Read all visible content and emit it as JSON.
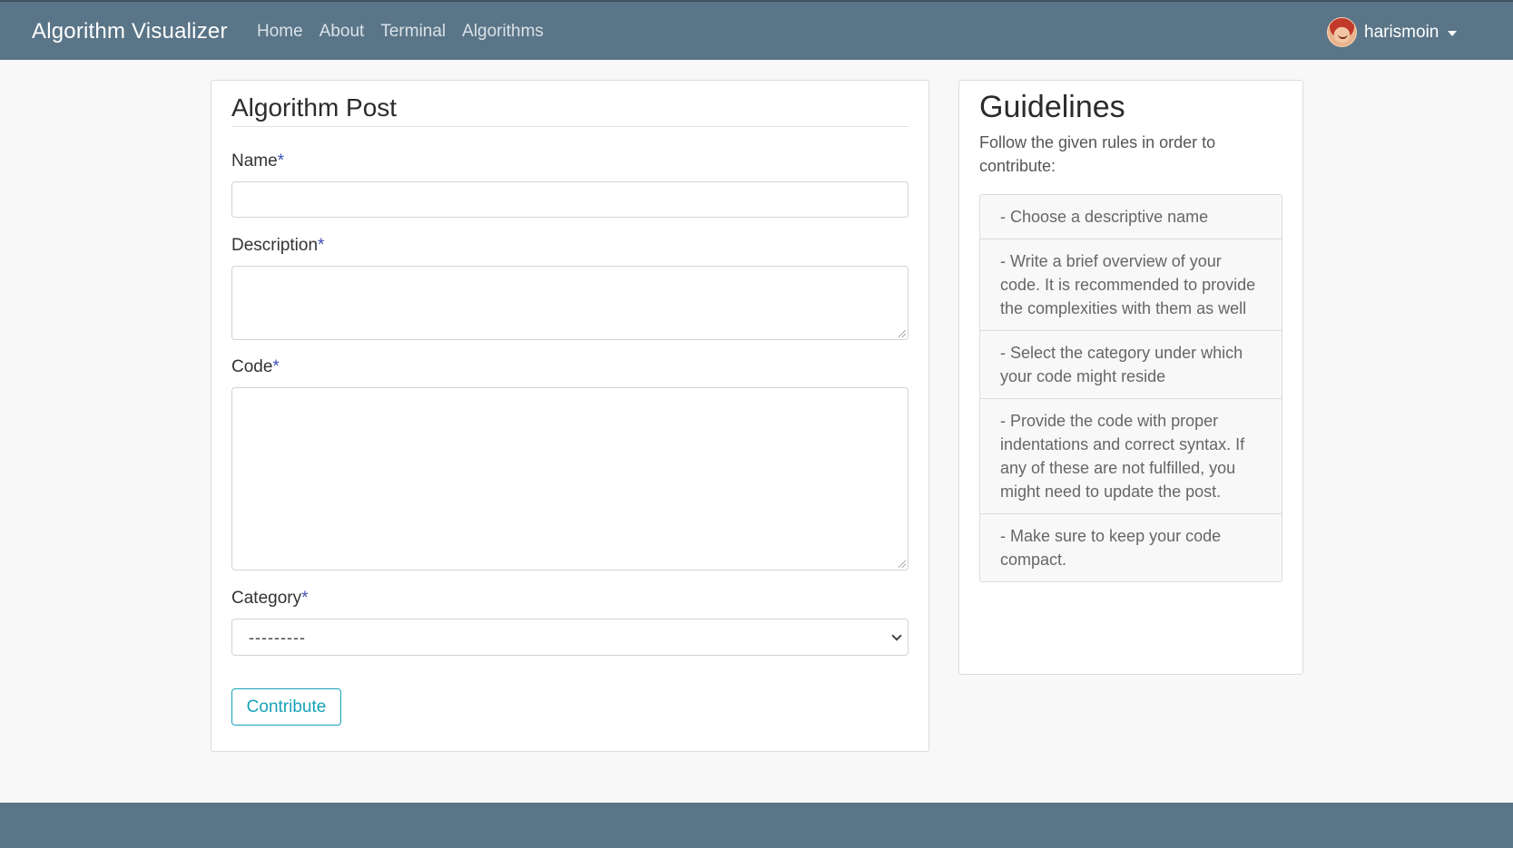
{
  "navbar": {
    "brand": "Algorithm Visualizer",
    "links": [
      "Home",
      "About",
      "Terminal",
      "Algorithms"
    ],
    "user": {
      "name": "harismoin",
      "avatar_icon": "avatar"
    }
  },
  "post_form": {
    "title": "Algorithm Post",
    "required_mark": "*",
    "name_label": "Name",
    "name_value": "",
    "description_label": "Description",
    "description_value": "",
    "code_label": "Code",
    "code_value": "",
    "category_label": "Category",
    "category_selected": "---------",
    "submit_label": "Contribute"
  },
  "guidelines": {
    "title": "Guidelines",
    "intro": "Follow the given rules in order to contribute:",
    "items": [
      "- Choose a descriptive name",
      "- Write a brief overview of your code. It is recommended to provide the complexities with them as well",
      "- Select the category under which your code might reside",
      "- Provide the code with proper indentations and correct syntax. If any of these are not fulfilled, you might need to update the post.",
      "- Make sure to keep your code compact."
    ]
  },
  "colors": {
    "navbar": "#5a7587",
    "accent": "#17a2b8",
    "required": "#3f51b5"
  }
}
